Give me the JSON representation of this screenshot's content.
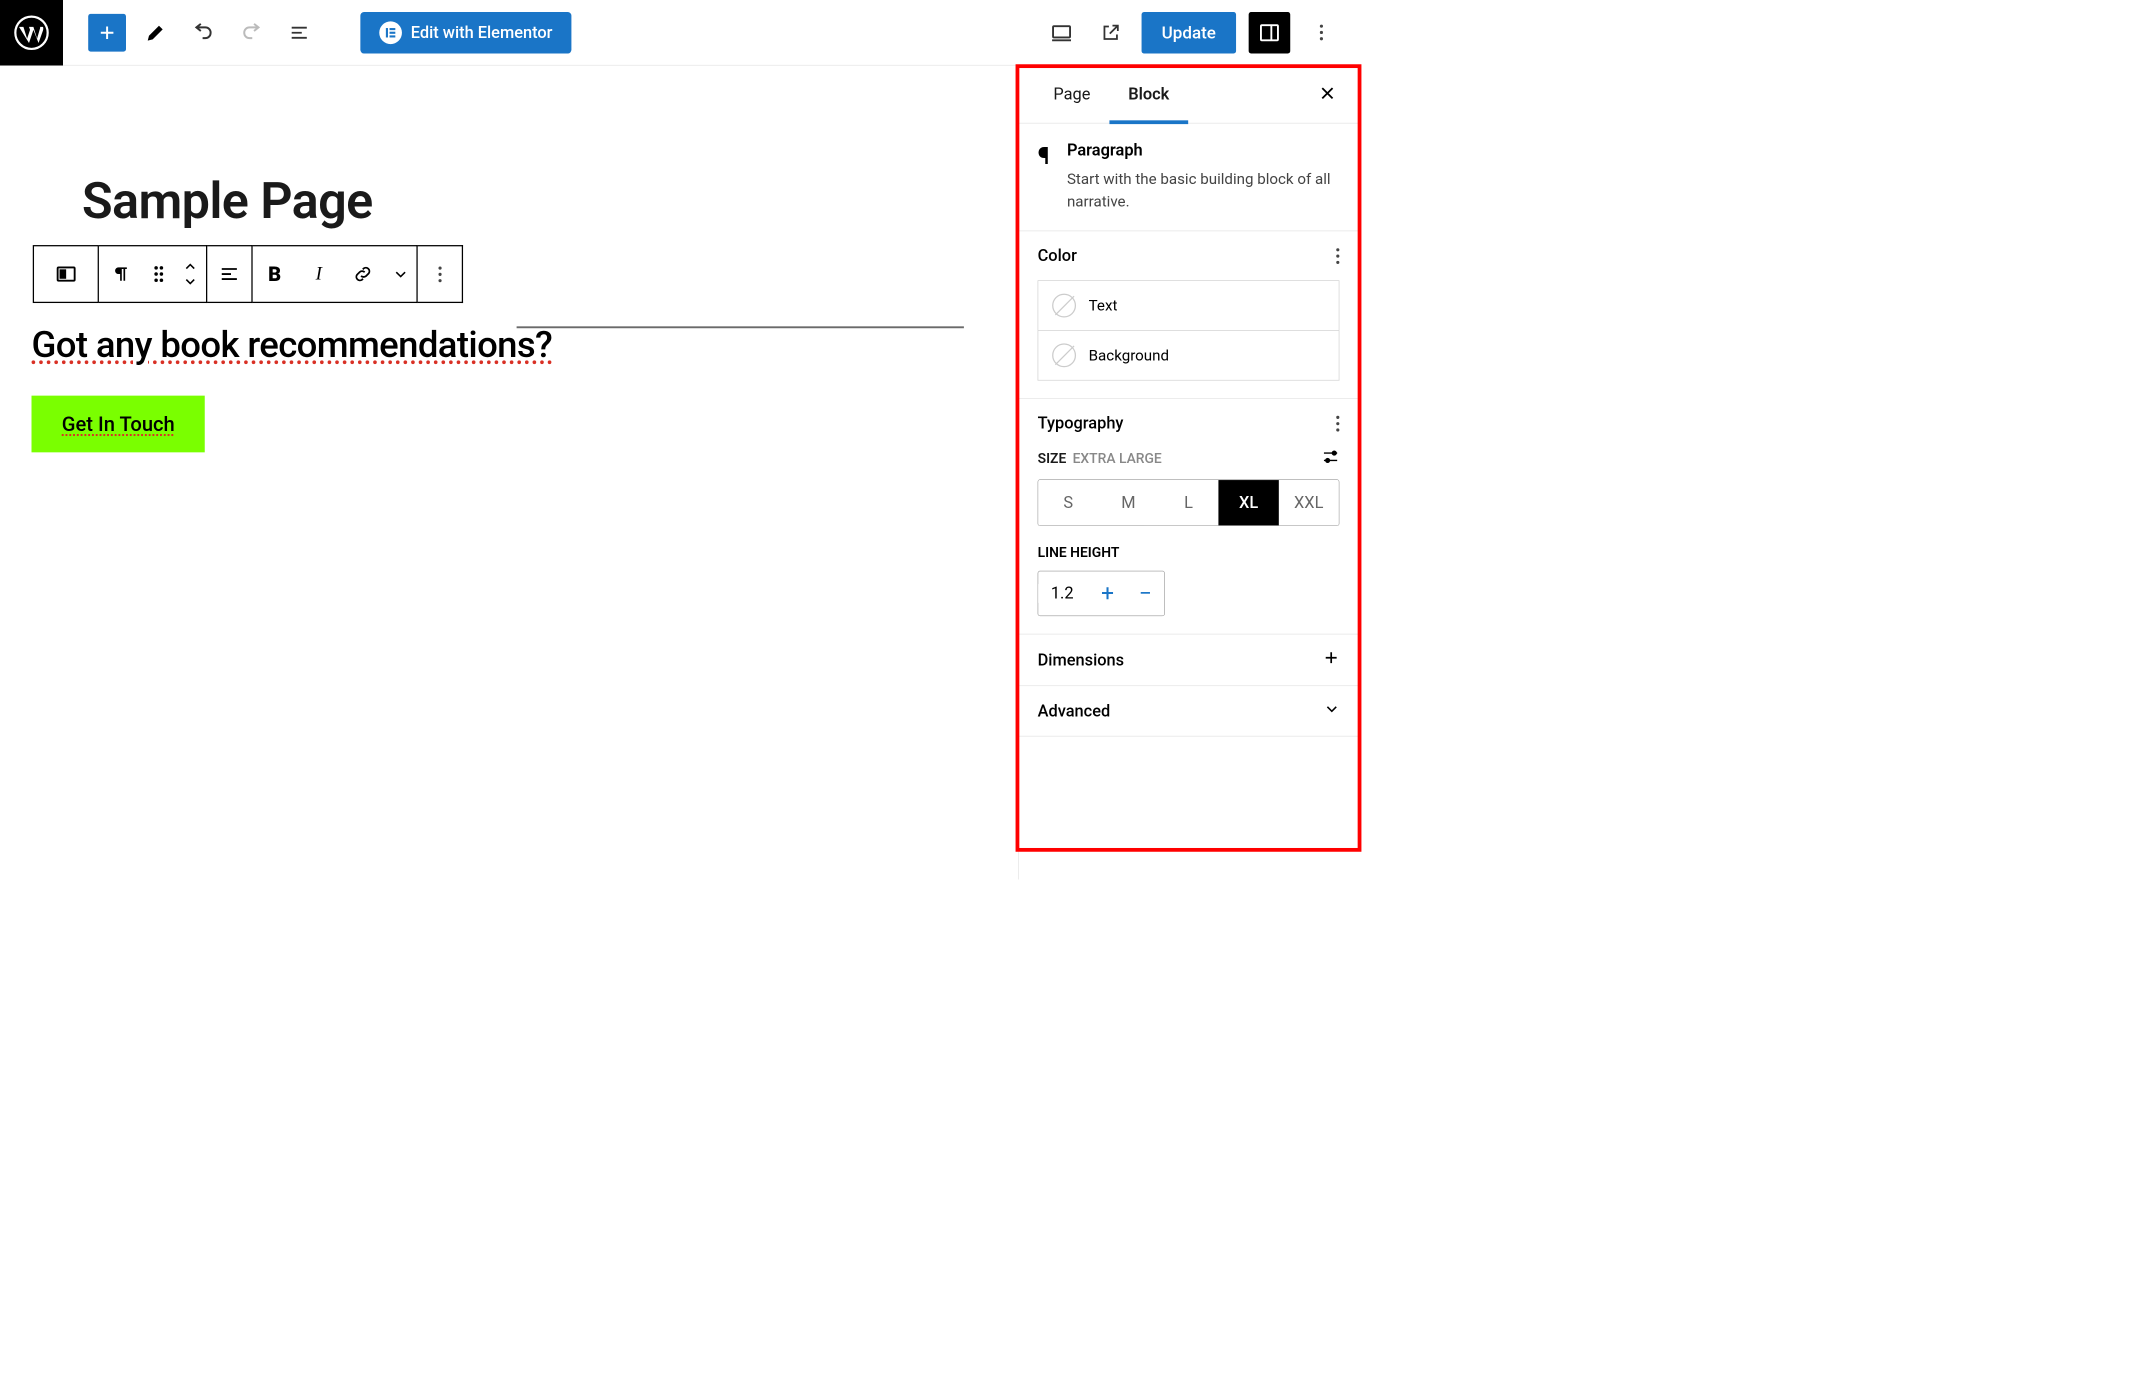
{
  "toolbar": {
    "elementor_label": "Edit with Elementor",
    "update_label": "Update"
  },
  "editor": {
    "page_title": "Sample Page",
    "paragraph_text": "Got any book recommendations?",
    "cta_label": "Get In Touch"
  },
  "sidebar": {
    "tabs": {
      "page": "Page",
      "block": "Block"
    },
    "block_info": {
      "title": "Paragraph",
      "description": "Start with the basic building block of all narrative."
    },
    "panels": {
      "color": {
        "title": "Color",
        "text_label": "Text",
        "bg_label": "Background"
      },
      "typography": {
        "title": "Typography",
        "size_label": "SIZE",
        "size_value_label": "EXTRA LARGE",
        "sizes": [
          "S",
          "M",
          "L",
          "XL",
          "XXL"
        ],
        "active_size": "XL",
        "line_height_label": "LINE HEIGHT",
        "line_height_value": "1.2"
      },
      "dimensions": {
        "title": "Dimensions"
      },
      "advanced": {
        "title": "Advanced"
      }
    }
  }
}
